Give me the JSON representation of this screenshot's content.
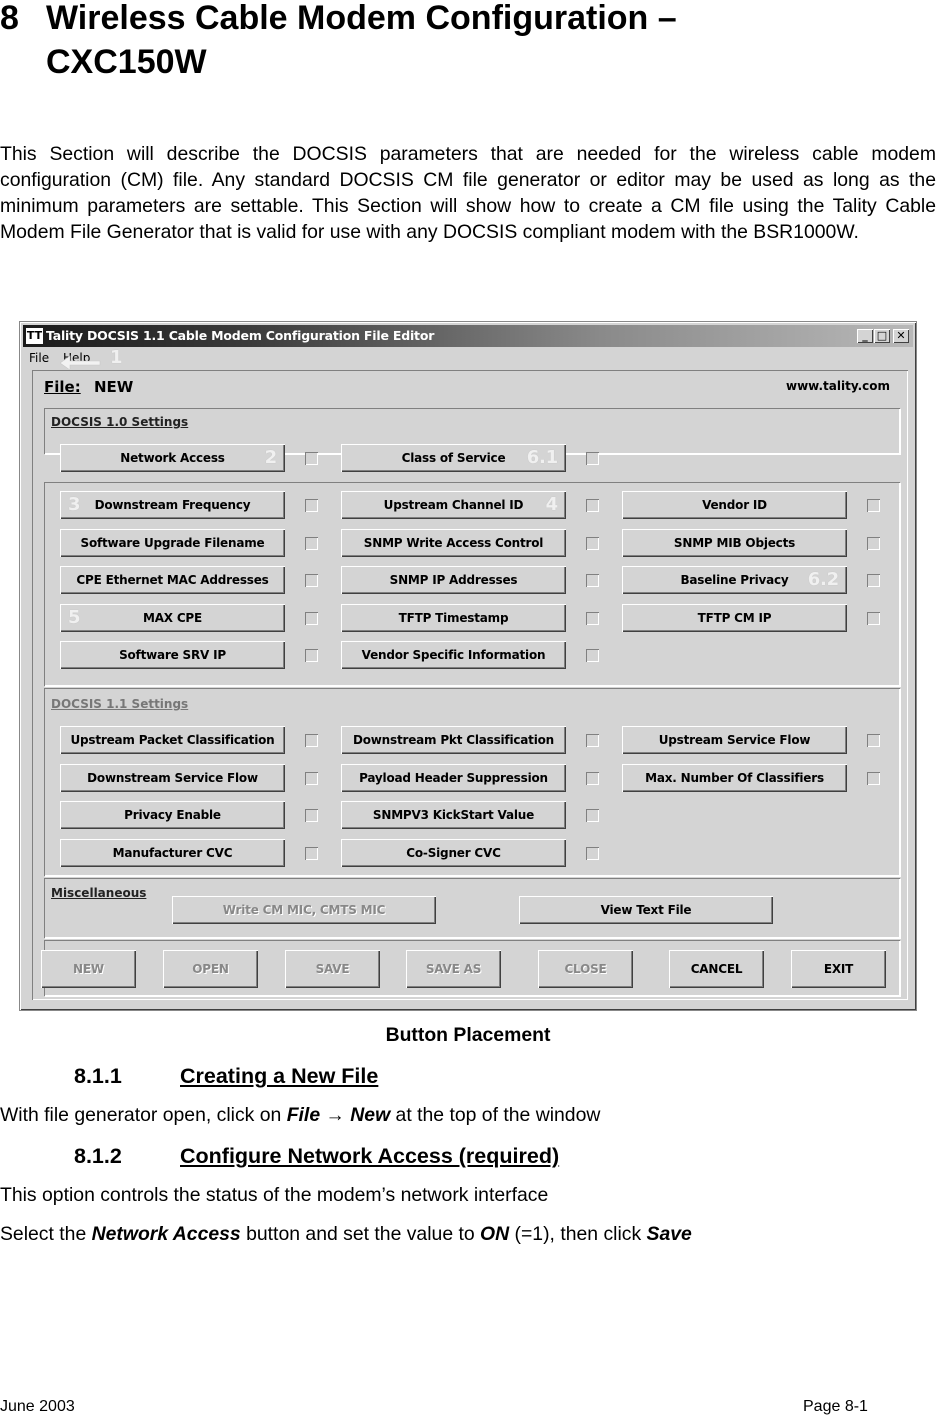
{
  "heading": {
    "number": "8",
    "title_line1": "Wireless Cable Modem Configuration –",
    "title_line2": "CXC150W"
  },
  "intro": "This Section will describe the DOCSIS parameters that are needed for the wireless cable modem configuration (CM) file.  Any standard DOCSIS CM file generator or editor may be used as long as the minimum parameters are settable. This Section will show how to create a CM file using the Tality Cable Modem File Generator that is valid for use with any DOCSIS compliant modem with the BSR1000W.",
  "window": {
    "title": "Tality DOCSIS 1.1 Cable Modem Configuration File Editor",
    "app_icon": "tality-app-icon",
    "controls": {
      "minimize": "_",
      "maximize": "□",
      "close": "✕"
    },
    "menu": [
      {
        "label": "File",
        "accel": "F"
      },
      {
        "label": "Help",
        "accel": "H"
      }
    ],
    "menu_annotation": "1",
    "file_label": "File:",
    "file_name": "NEW",
    "url": "www.tality.com",
    "docsis10": {
      "label": "DOCSIS 1.0 Settings",
      "top_row": [
        {
          "label": "Network Access",
          "annotation": "2",
          "checked": false
        },
        {
          "label": "Class of Service",
          "annotation": "6.1",
          "checked": false
        }
      ],
      "grid": [
        [
          {
            "label": "Downstream Frequency",
            "annotation": "3",
            "checked": false
          },
          {
            "label": "Upstream Channel ID",
            "annotation": "4",
            "checked": false
          },
          {
            "label": "Vendor ID",
            "checked": false
          }
        ],
        [
          {
            "label": "Software Upgrade Filename",
            "checked": false
          },
          {
            "label": "SNMP Write Access Control",
            "checked": false
          },
          {
            "label": "SNMP MIB Objects",
            "checked": false
          }
        ],
        [
          {
            "label": "CPE Ethernet MAC Addresses",
            "checked": false
          },
          {
            "label": "SNMP IP Addresses",
            "checked": false
          },
          {
            "label": "Baseline Privacy",
            "annotation": "6.2",
            "checked": false
          }
        ],
        [
          {
            "label": "MAX CPE",
            "annotation": "5",
            "checked": false
          },
          {
            "label": "TFTP Timestamp",
            "checked": false
          },
          {
            "label": "TFTP CM IP",
            "checked": false
          }
        ],
        [
          {
            "label": "Software SRV IP",
            "checked": false
          },
          {
            "label": "Vendor Specific Information",
            "checked": false
          }
        ]
      ]
    },
    "docsis11": {
      "label": "DOCSIS 1.1 Settings",
      "grid": [
        [
          {
            "label": "Upstream Packet Classification",
            "checked": false
          },
          {
            "label": "Downstream Pkt Classification",
            "checked": false
          },
          {
            "label": "Upstream Service Flow",
            "checked": false
          }
        ],
        [
          {
            "label": "Downstream Service Flow",
            "checked": false
          },
          {
            "label": "Payload Header Suppression",
            "checked": false
          },
          {
            "label": "Max. Number Of Classifiers",
            "checked": false
          }
        ],
        [
          {
            "label": "Privacy Enable",
            "checked": false
          },
          {
            "label": "SNMPV3 KickStart Value",
            "checked": false
          }
        ],
        [
          {
            "label": "Manufacturer CVC",
            "checked": false
          },
          {
            "label": "Co-Signer CVC",
            "checked": false
          }
        ]
      ]
    },
    "misc": {
      "label": "Miscellaneous",
      "write_mic": {
        "label": "Write CM MIC, CMTS MIC",
        "enabled": false
      },
      "view_text": {
        "label": "View Text File",
        "enabled": true
      }
    },
    "actions": [
      {
        "label": "NEW",
        "enabled": false
      },
      {
        "label": "OPEN",
        "enabled": false
      },
      {
        "label": "SAVE",
        "enabled": false
      },
      {
        "label": "SAVE AS",
        "enabled": false
      },
      {
        "label": "CLOSE",
        "enabled": false
      },
      {
        "label": "CANCEL",
        "enabled": true
      },
      {
        "label": "EXIT",
        "enabled": true
      }
    ]
  },
  "caption": "Button Placement",
  "sections": [
    {
      "number": "8.1.1",
      "title": "Creating a New File"
    },
    {
      "number": "8.1.2",
      "title": "Configure Network Access (required)"
    }
  ],
  "step1": {
    "pre": "With file generator open, click on ",
    "b1": "File",
    "arrow": " → ",
    "b2": "New",
    "post": " at the top of the window"
  },
  "step2_desc": "This option controls the status of the modem’s network interface",
  "step2": {
    "pre": "Select the ",
    "b1": "Network Access",
    "mid": " button and set the value to ",
    "b2": "ON",
    "mid2": " (=1), then click ",
    "b3": "Save"
  },
  "footer": {
    "left": "June 2003",
    "right": "Page 8-1"
  }
}
